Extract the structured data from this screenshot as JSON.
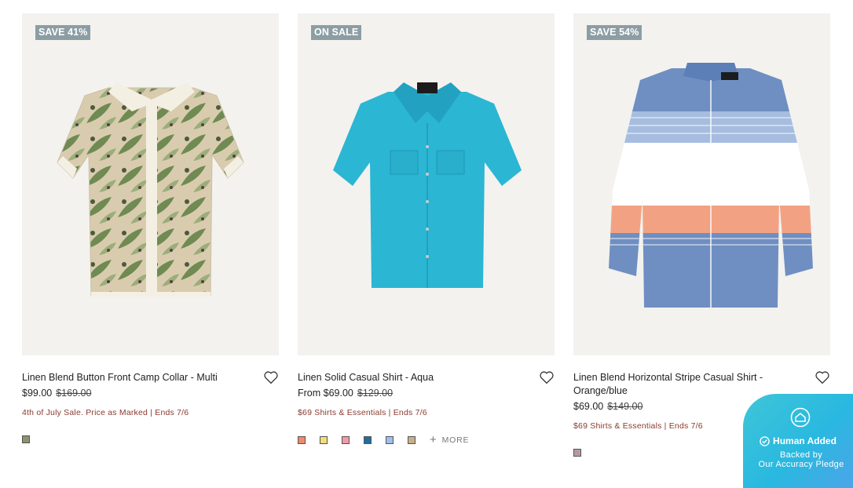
{
  "products": [
    {
      "badge": "SAVE 41%",
      "title": "Linen Blend Button Front Camp Collar - Multi",
      "price": "$99.00",
      "old_price": "$169.00",
      "promo": "4th of July Sale. Price as Marked | Ends 7/6",
      "swatches": [
        "#8a9470"
      ]
    },
    {
      "badge": "ON SALE",
      "title": "Linen Solid Casual Shirt - Aqua",
      "price": "From $69.00",
      "old_price": "$129.00",
      "promo": "$69 Shirts & Essentials | Ends 7/6",
      "swatches": [
        "#f08a6a",
        "#f2dd7a",
        "#f09aa8",
        "#1f6fa0",
        "#9ec0ec",
        "#c8b08a"
      ],
      "more_label": "MORE"
    },
    {
      "badge": "SAVE 54%",
      "title_line1": "Linen Blend Horizontal Stripe Casual Shirt -",
      "title_line2": "Orange/blue",
      "price": "$69.00",
      "old_price": "$149.00",
      "promo": "$69 Shirts & Essentials | Ends 7/6",
      "swatches": [
        "#b59aa6"
      ]
    }
  ],
  "accuracy_widget": {
    "title": "Human Added",
    "line1": "Backed by",
    "line2": "Our Accuracy Pledge"
  },
  "colors": {
    "image_bg": "#f3f2ee",
    "badge_bg": "#8c9ea3",
    "promo_text": "#8a3a2e",
    "widget": "#3ec6d8"
  },
  "icons": [
    "heart-icon",
    "plus-icon",
    "check-circle-icon",
    "home-badge-icon"
  ]
}
